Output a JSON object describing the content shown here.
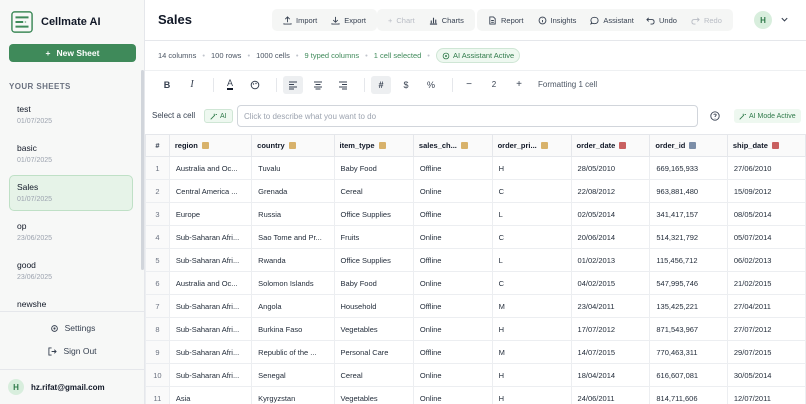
{
  "app": {
    "name": "Cellmate AI"
  },
  "sidebar": {
    "new_sheet_label": "New Sheet",
    "heading": "YOUR SHEETS",
    "sheets": [
      {
        "name": "test",
        "date": "01/07/2025"
      },
      {
        "name": "basic",
        "date": "01/07/2025"
      },
      {
        "name": "Sales",
        "date": "01/07/2025",
        "active": true
      },
      {
        "name": "op",
        "date": "23/06/2025"
      },
      {
        "name": "good",
        "date": "23/06/2025"
      },
      {
        "name": "newshe",
        "date": ""
      }
    ],
    "settings_label": "Settings",
    "signout_label": "Sign Out",
    "user": {
      "initial": "H",
      "email": "hz.rifat@gmail.com"
    }
  },
  "header": {
    "title": "Sales",
    "actions": [
      {
        "label": "Import",
        "icon": "upload-icon",
        "enabled": true
      },
      {
        "label": "Export",
        "icon": "download-icon",
        "enabled": true
      }
    ],
    "tools": [
      {
        "label": "Chart",
        "icon": "plus-icon",
        "enabled": false
      },
      {
        "label": "Charts",
        "icon": "bar-chart-icon",
        "enabled": true
      },
      {
        "label": "Report",
        "icon": "file-icon",
        "enabled": true
      },
      {
        "label": "Insights",
        "icon": "info-icon",
        "enabled": true
      },
      {
        "label": "Assistant",
        "icon": "chat-icon",
        "enabled": true
      },
      {
        "label": "Undo",
        "icon": "undo-icon",
        "enabled": true
      },
      {
        "label": "Redo",
        "icon": "redo-icon",
        "enabled": false
      }
    ],
    "avatar_initial": "H"
  },
  "infobar": {
    "columns": "14 columns",
    "rows": "100 rows",
    "cells": "1000 cells",
    "typed": "9 typed columns",
    "selected": "1 cell selected",
    "ai_status": "AI Assistant Active"
  },
  "format": {
    "font_size": "2",
    "status": "Formatting 1 cell"
  },
  "command": {
    "label": "Select a cell",
    "ai_pill": "AI",
    "placeholder": "Click to describe what you want to do",
    "mode": "AI Mode Active"
  },
  "grid": {
    "row_header": "#",
    "columns": [
      {
        "label": "region",
        "type": "text"
      },
      {
        "label": "country",
        "type": "text"
      },
      {
        "label": "item_type",
        "type": "text"
      },
      {
        "label": "sales_ch...",
        "type": "text"
      },
      {
        "label": "order_pri...",
        "type": "text"
      },
      {
        "label": "order_date",
        "type": "date"
      },
      {
        "label": "order_id",
        "type": "number"
      },
      {
        "label": "ship_date",
        "type": "date"
      }
    ],
    "rows": [
      [
        "1",
        "Australia and Oc...",
        "Tuvalu",
        "Baby Food",
        "Offline",
        "H",
        "28/05/2010",
        "669,165,933",
        "27/06/2010"
      ],
      [
        "2",
        "Central America ...",
        "Grenada",
        "Cereal",
        "Online",
        "C",
        "22/08/2012",
        "963,881,480",
        "15/09/2012"
      ],
      [
        "3",
        "Europe",
        "Russia",
        "Office Supplies",
        "Offline",
        "L",
        "02/05/2014",
        "341,417,157",
        "08/05/2014"
      ],
      [
        "4",
        "Sub-Saharan Afri...",
        "Sao Tome and Pr...",
        "Fruits",
        "Online",
        "C",
        "20/06/2014",
        "514,321,792",
        "05/07/2014"
      ],
      [
        "5",
        "Sub-Saharan Afri...",
        "Rwanda",
        "Office Supplies",
        "Offline",
        "L",
        "01/02/2013",
        "115,456,712",
        "06/02/2013"
      ],
      [
        "6",
        "Australia and Oc...",
        "Solomon Islands",
        "Baby Food",
        "Online",
        "C",
        "04/02/2015",
        "547,995,746",
        "21/02/2015"
      ],
      [
        "7",
        "Sub-Saharan Afri...",
        "Angola",
        "Household",
        "Offline",
        "M",
        "23/04/2011",
        "135,425,221",
        "27/04/2011"
      ],
      [
        "8",
        "Sub-Saharan Afri...",
        "Burkina Faso",
        "Vegetables",
        "Online",
        "H",
        "17/07/2012",
        "871,543,967",
        "27/07/2012"
      ],
      [
        "9",
        "Sub-Saharan Afri...",
        "Republic of the ...",
        "Personal Care",
        "Offline",
        "M",
        "14/07/2015",
        "770,463,311",
        "29/07/2015"
      ],
      [
        "10",
        "Sub-Saharan Afri...",
        "Senegal",
        "Cereal",
        "Online",
        "H",
        "18/04/2014",
        "616,607,081",
        "30/05/2014"
      ],
      [
        "11",
        "Asia",
        "Kyrgyzstan",
        "Vegetables",
        "Online",
        "H",
        "24/06/2011",
        "814,711,606",
        "12/07/2011"
      ]
    ]
  }
}
